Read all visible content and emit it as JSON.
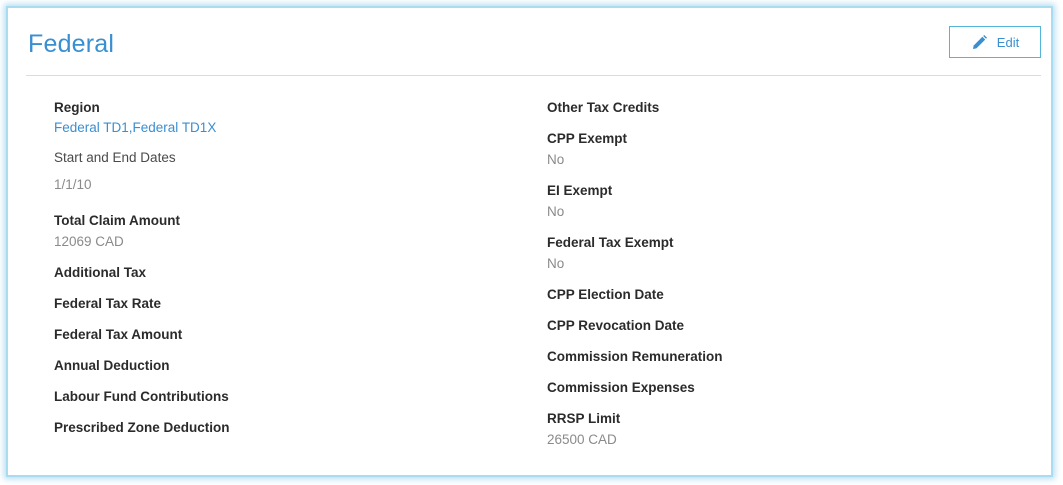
{
  "panel": {
    "title": "Federal",
    "edit_label": "Edit",
    "edit_icon": "pencil-icon"
  },
  "left_fields": {
    "region": {
      "label": "Region",
      "value": "Federal TD1,Federal TD1X"
    },
    "dates": {
      "label": "Start and End Dates",
      "value": "1/1/10"
    },
    "total_claim": {
      "label": "Total Claim Amount",
      "value": "12069 CAD"
    },
    "additional_tax": {
      "label": "Additional Tax"
    },
    "federal_tax_rate": {
      "label": "Federal Tax Rate"
    },
    "federal_tax_amount": {
      "label": "Federal Tax Amount"
    },
    "annual_deduction": {
      "label": "Annual Deduction"
    },
    "labour_fund": {
      "label": "Labour Fund Contributions"
    },
    "prescribed_zone": {
      "label": "Prescribed Zone Deduction"
    }
  },
  "right_fields": {
    "other_credits": {
      "label": "Other Tax Credits"
    },
    "cpp_exempt": {
      "label": "CPP Exempt",
      "value": "No"
    },
    "ei_exempt": {
      "label": "EI Exempt",
      "value": "No"
    },
    "federal_tax_exempt": {
      "label": "Federal Tax Exempt",
      "value": "No"
    },
    "cpp_election_date": {
      "label": "CPP Election Date"
    },
    "cpp_revocation_date": {
      "label": "CPP Revocation Date"
    },
    "commission_remuneration": {
      "label": "Commission Remuneration"
    },
    "commission_expenses": {
      "label": "Commission Expenses"
    },
    "rrsp_limit": {
      "label": "RRSP Limit",
      "value": "26500 CAD"
    }
  },
  "colors": {
    "accent": "#3a8fd1",
    "frame_glow": "#a9dcf0",
    "button_border": "#53b5d9",
    "muted_text": "#8a8a8a"
  }
}
